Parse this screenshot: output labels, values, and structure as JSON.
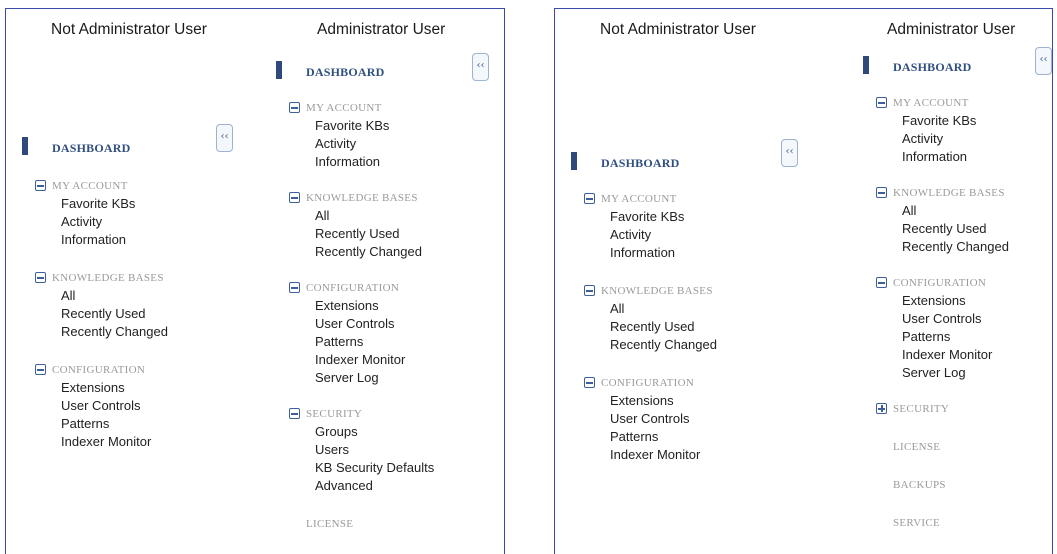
{
  "panels": [
    {
      "non_admin": {
        "title": "Not Administrator User",
        "menu": {
          "dashboard": "DASHBOARD",
          "sections": [
            {
              "title": "MY ACCOUNT",
              "items": [
                "Favorite KBs",
                "Activity",
                "Information"
              ]
            },
            {
              "title": "KNOWLEDGE BASES",
              "items": [
                "All",
                "Recently Used",
                "Recently Changed"
              ]
            },
            {
              "title": "CONFIGURATION",
              "items": [
                "Extensions",
                "User Controls",
                "Patterns",
                "Indexer Monitor"
              ]
            }
          ]
        }
      },
      "admin": {
        "title": "Administrator User",
        "menu": {
          "dashboard": "DASHBOARD",
          "sections": [
            {
              "title": "MY ACCOUNT",
              "items": [
                "Favorite KBs",
                "Activity",
                "Information"
              ]
            },
            {
              "title": "KNOWLEDGE BASES",
              "items": [
                "All",
                "Recently Used",
                "Recently Changed"
              ]
            },
            {
              "title": "CONFIGURATION",
              "items": [
                "Extensions",
                "User Controls",
                "Patterns",
                "Indexer Monitor",
                "Server Log"
              ]
            },
            {
              "title": "SECURITY",
              "items": [
                "Groups",
                "Users",
                "KB Security Defaults",
                "Advanced"
              ]
            }
          ],
          "extra": [
            "LICENSE"
          ]
        }
      }
    },
    {
      "non_admin": {
        "title": "Not Administrator User",
        "menu": {
          "dashboard": "DASHBOARD",
          "sections": [
            {
              "title": "MY ACCOUNT",
              "items": [
                "Favorite KBs",
                "Activity",
                "Information"
              ]
            },
            {
              "title": "KNOWLEDGE BASES",
              "items": [
                "All",
                "Recently Used",
                "Recently Changed"
              ]
            },
            {
              "title": "CONFIGURATION",
              "items": [
                "Extensions",
                "User Controls",
                "Patterns",
                "Indexer Monitor"
              ]
            }
          ]
        }
      },
      "admin": {
        "title": "Administrator User",
        "menu": {
          "dashboard": "DASHBOARD",
          "sections": [
            {
              "title": "MY ACCOUNT",
              "items": [
                "Favorite KBs",
                "Activity",
                "Information"
              ]
            },
            {
              "title": "KNOWLEDGE BASES",
              "items": [
                "All",
                "Recently Used",
                "Recently Changed"
              ]
            },
            {
              "title": "CONFIGURATION",
              "items": [
                "Extensions",
                "User Controls",
                "Patterns",
                "Indexer Monitor",
                "Server Log"
              ]
            }
          ],
          "security_collapsed": "SECURITY",
          "extra": [
            "LICENSE",
            "BACKUPS",
            "SERVICE"
          ]
        }
      }
    }
  ],
  "collapse_button_glyph": "‹‹",
  "colors": {
    "border": "#3a4aa8",
    "dashboard_text": "#2f4f7f",
    "section_text": "#9a9a9a",
    "toggle_icon": "#3d5f9a"
  }
}
